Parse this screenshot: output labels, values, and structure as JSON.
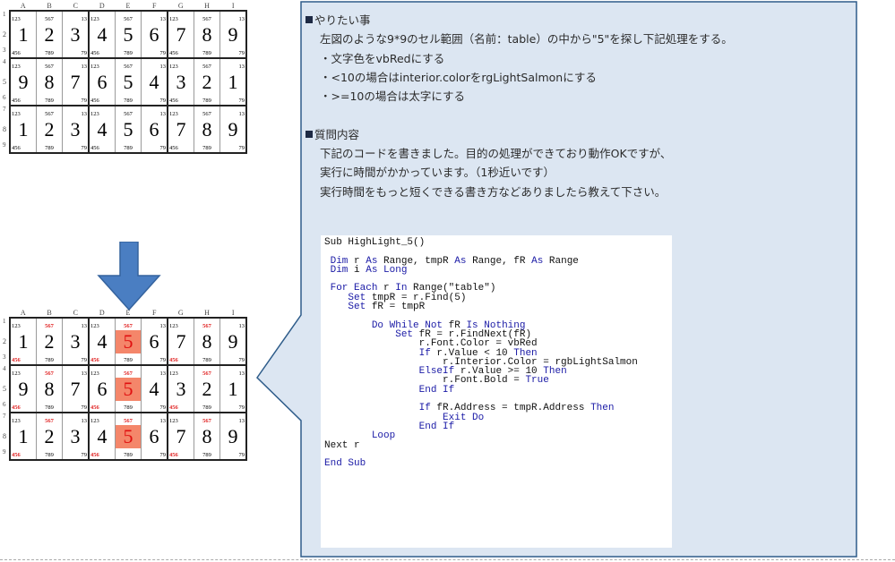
{
  "top_grid": {
    "col_headers": [
      "A",
      "B",
      "C",
      "D",
      "E",
      "F",
      "G",
      "H",
      "I"
    ],
    "row_numbers": [
      "1",
      "2",
      "3",
      "4",
      "5",
      "6",
      "7",
      "8",
      "9"
    ],
    "top_subs": [
      "123",
      "567",
      "13"
    ],
    "bot_subs": [
      "456",
      "789",
      "79"
    ],
    "rows": [
      [
        "1",
        "2",
        "3",
        "4",
        "5",
        "6",
        "7",
        "8",
        "9"
      ],
      [
        "9",
        "8",
        "7",
        "6",
        "5",
        "4",
        "3",
        "2",
        "1"
      ],
      [
        "1",
        "2",
        "3",
        "4",
        "5",
        "6",
        "7",
        "8",
        "9"
      ]
    ]
  },
  "bottom_grid": {
    "col_headers": [
      "A",
      "B",
      "C",
      "D",
      "E",
      "F",
      "G",
      "H",
      "I"
    ],
    "row_numbers": [
      "1",
      "2",
      "3",
      "4",
      "5",
      "6",
      "7",
      "8",
      "9"
    ],
    "top_subs": [
      "123",
      "567",
      "13"
    ],
    "bot_subs": [
      "456",
      "789",
      "79"
    ],
    "rows": [
      [
        "1",
        "2",
        "3",
        "4",
        "5",
        "6",
        "7",
        "8",
        "9"
      ],
      [
        "9",
        "8",
        "7",
        "6",
        "5",
        "4",
        "3",
        "2",
        "1"
      ],
      [
        "1",
        "2",
        "3",
        "4",
        "5",
        "6",
        "7",
        "8",
        "9"
      ]
    ],
    "highlight_color": "#f4866a",
    "red_color": "#e02020"
  },
  "arrow_color": "#4a7ec2",
  "panel": {
    "bg": "#dce6f2",
    "border": "#2e5c8a",
    "lines": [
      {
        "type": "head",
        "text": "やりたい事"
      },
      {
        "type": "body",
        "text": "左図のような9*9のセル範囲（名前：table）の中から\"5\"を探し下記処理をする。"
      },
      {
        "type": "body",
        "text": "・文字色をvbRedにする"
      },
      {
        "type": "body",
        "text": "・<10の場合はinterior.colorをrgLightSalmonにする"
      },
      {
        "type": "body",
        "text": "・>=10の場合は太字にする"
      },
      {
        "type": "blank",
        "text": ""
      },
      {
        "type": "head",
        "text": "質問内容"
      },
      {
        "type": "body",
        "text": "下記のコードを書きました。目的の処理ができており動作OKですが、"
      },
      {
        "type": "body",
        "text": "実行に時間がかかっています。（1秒近いです）"
      },
      {
        "type": "body",
        "text": "実行時間をもっと短くできる書き方などありましたら教えて下さい。"
      }
    ]
  },
  "code": "Sub HighLight_5()\n\n Dim r As Range, tmpR As Range, fR As Range\n Dim i As Long\n\n For Each r In Range(\"table\")\n    Set tmpR = r.Find(5)\n    Set fR = tmpR\n\n        Do While Not fR Is Nothing\n            Set fR = r.FindNext(fR)\n                r.Font.Color = vbRed\n                If r.Value < 10 Then\n                    r.Interior.Color = rgbLightSalmon\n                ElseIf r.Value >= 10 Then\n                    r.Font.Bold = True\n                End If\n\n                If fR.Address = tmpR.Address Then\n                    Exit Do\n                End If\n        Loop\nNext r\n\nEnd Sub"
}
